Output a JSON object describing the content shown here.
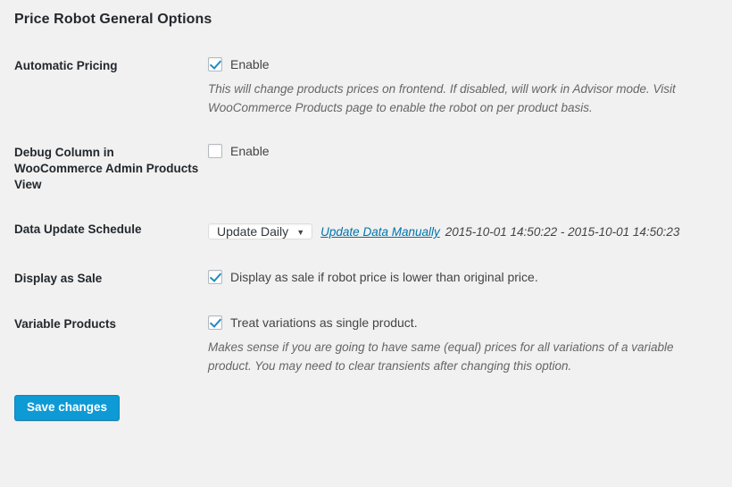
{
  "page": {
    "title": "Price Robot General Options"
  },
  "rows": {
    "automatic_pricing": {
      "label": "Automatic Pricing",
      "checkbox_label": "Enable",
      "checked": true,
      "description": "This will change products prices on frontend. If disabled, will work in Advisor mode. Visit WooCommerce Products page to enable the robot on per product basis."
    },
    "debug_column": {
      "label": "Debug Column in WooCommerce Admin Products View",
      "checkbox_label": "Enable",
      "checked": false
    },
    "data_update_schedule": {
      "label": "Data Update Schedule",
      "selected_option": "Update Daily",
      "manual_link": "Update Data Manually",
      "timestamps": "2015-10-01 14:50:22 - 2015-10-01 14:50:23"
    },
    "display_as_sale": {
      "label": "Display as Sale",
      "checkbox_label": "Display as sale if robot price is lower than original price.",
      "checked": true
    },
    "variable_products": {
      "label": "Variable Products",
      "checkbox_label": "Treat variations as single product.",
      "checked": true,
      "description": "Makes sense if you are going to have same (equal) prices for all variations of a variable product. You may need to clear transients after changing this option."
    }
  },
  "submit": {
    "save_label": "Save changes"
  },
  "icons": {
    "dropdown_arrow": "▼"
  },
  "colors": {
    "accent_blue": "#0e9ad4",
    "link_blue": "#0073aa",
    "check_blue": "#1e8cbe",
    "background": "#f1f1f1",
    "heading": "#23282d"
  }
}
